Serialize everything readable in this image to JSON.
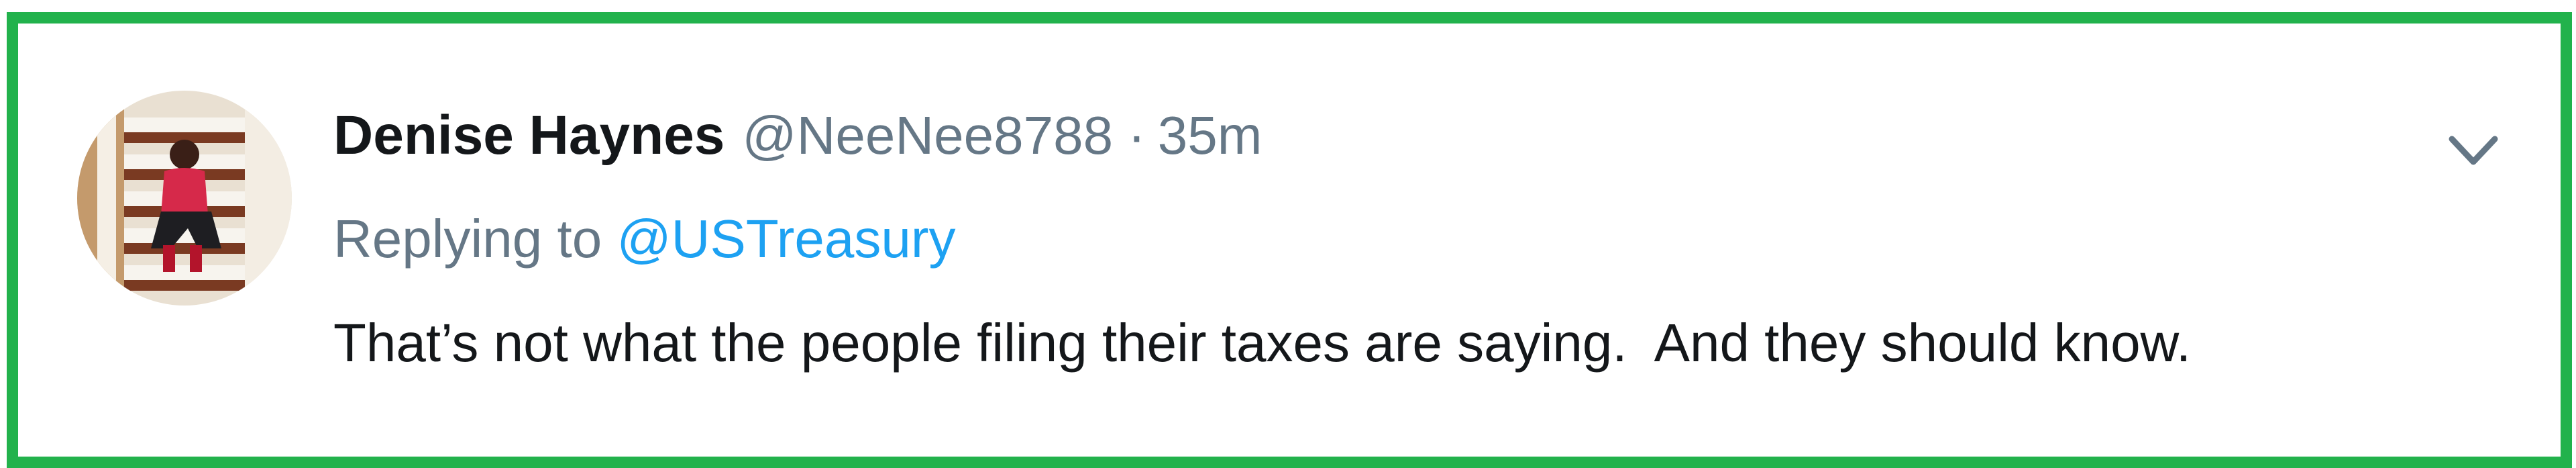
{
  "tweet": {
    "author_name": "Denise Haynes",
    "author_handle": "@NeeNee8788",
    "separator": "·",
    "timestamp": "35m",
    "replying_to_prefix": "Replying to ",
    "replying_to_handle": "@USTreasury",
    "text": "That’s not what the people filing their taxes are saying.  And they should know.",
    "menu_icon": "chevron-down-icon"
  },
  "colors": {
    "frame_border": "#22b24c",
    "link_blue": "#1da1f2",
    "secondary_gray": "#657786",
    "primary_text": "#14171a"
  }
}
